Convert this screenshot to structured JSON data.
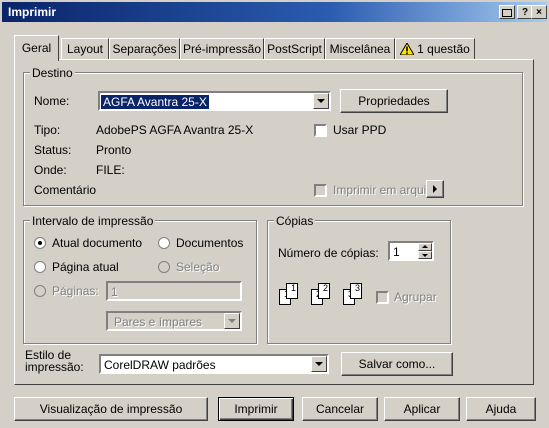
{
  "window": {
    "title": "Imprimir",
    "help_button": "?"
  },
  "tabs": [
    {
      "label": "Geral"
    },
    {
      "label": "Layout"
    },
    {
      "label": "Separações"
    },
    {
      "label": "Pré-impressão"
    },
    {
      "label": "PostScript"
    },
    {
      "label": "Miscelânea"
    },
    {
      "label": "1 questão"
    }
  ],
  "destino": {
    "legend": "Destino",
    "nome_label": "Nome:",
    "nome_value": "AGFA Avantra 25-X",
    "propriedades_button": "Propriedades",
    "tipo_label": "Tipo:",
    "tipo_value": "AdobePS AGFA Avantra 25-X",
    "usar_ppd_label": "Usar PPD",
    "status_label": "Status:",
    "status_value": "Pronto",
    "onde_label": "Onde:",
    "onde_value": "FILE:",
    "comentario_label": "Comentário",
    "imprimir_arquivo_label": "Imprimir em arquivo"
  },
  "intervalo": {
    "legend": "Intervalo de impressão",
    "atual_documento": "Atual documento",
    "documentos": "Documentos",
    "pagina_atual": "Página atual",
    "selecao": "Seleção",
    "paginas_label": "Páginas:",
    "paginas_value": "1",
    "pares_impares": "Pares e ímpares"
  },
  "copias": {
    "legend": "Cópias",
    "numero_label": "Número de cópias:",
    "numero_value": "1",
    "agrupar_label": "Agrupar",
    "pages": [
      "1",
      "1",
      "2",
      "2",
      "3",
      "3"
    ]
  },
  "estilo": {
    "label_line1": "Estilo de",
    "label_line2": "impressão:",
    "value": "CorelDRAW padrões",
    "salvar_button": "Salvar como..."
  },
  "footer": {
    "visualizacao": "Visualização de impressão",
    "imprimir": "Imprimir",
    "cancelar": "Cancelar",
    "aplicar": "Aplicar",
    "ajuda": "Ajuda"
  }
}
